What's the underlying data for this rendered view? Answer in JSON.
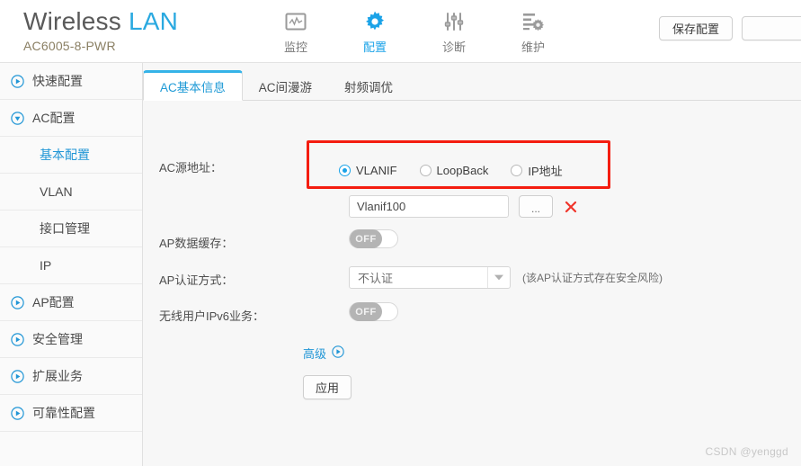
{
  "header": {
    "brand_primary": "Wireless",
    "brand_accent": "LAN",
    "model": "AC6005-8-PWR",
    "nav": [
      {
        "label": "监控",
        "icon": "monitor-chart-icon",
        "active": false
      },
      {
        "label": "配置",
        "icon": "gear-icon",
        "active": true
      },
      {
        "label": "诊断",
        "icon": "sliders-icon",
        "active": false
      },
      {
        "label": "维护",
        "icon": "maintenance-gear-list-icon",
        "active": false
      }
    ],
    "buttons": [
      {
        "label": "保存配置",
        "name": "save-config-button"
      },
      {
        "label": "",
        "name": "secondary-toolbar-button"
      }
    ]
  },
  "sidebar": {
    "items": [
      {
        "label": "快速配置",
        "icon": "circle-play-icon",
        "type": "group",
        "expanded": false,
        "active": false
      },
      {
        "label": "AC配置",
        "icon": "circle-chevron-down-icon",
        "type": "group",
        "expanded": true,
        "active": false
      },
      {
        "label": "基本配置",
        "type": "sub",
        "active": true
      },
      {
        "label": "VLAN",
        "type": "sub",
        "active": false
      },
      {
        "label": "接口管理",
        "type": "sub",
        "active": false
      },
      {
        "label": "IP",
        "type": "sub",
        "active": false
      },
      {
        "label": "AP配置",
        "icon": "circle-play-icon",
        "type": "group",
        "expanded": false,
        "active": false
      },
      {
        "label": "安全管理",
        "icon": "circle-play-icon",
        "type": "group",
        "expanded": false,
        "active": false
      },
      {
        "label": "扩展业务",
        "icon": "circle-play-icon",
        "type": "group",
        "expanded": false,
        "active": false
      },
      {
        "label": "可靠性配置",
        "icon": "circle-play-icon",
        "type": "group",
        "expanded": false,
        "active": false
      }
    ]
  },
  "main": {
    "tabs": [
      {
        "label": "AC基本信息",
        "active": true
      },
      {
        "label": "AC间漫游",
        "active": false
      },
      {
        "label": "射频调优",
        "active": false
      }
    ],
    "form": {
      "source_address": {
        "label": "AC源地址：",
        "options": [
          {
            "label": "VLANIF",
            "checked": true
          },
          {
            "label": "LoopBack",
            "checked": false
          },
          {
            "label": "IP地址",
            "checked": false
          }
        ],
        "value": "Vlanif100",
        "placeholder": "",
        "browse_label": "...",
        "clear_icon": "red-x-icon"
      },
      "ap_data_cache": {
        "label": "AP数据缓存：",
        "state": "OFF"
      },
      "ap_auth_mode": {
        "label": "AP认证方式：",
        "value": "不认证",
        "hint": "(该AP认证方式存在安全风险)"
      },
      "wireless_ipv6": {
        "label": "无线用户IPv6业务：",
        "state": "OFF"
      },
      "advanced_label": "高级",
      "apply_label": "应用"
    }
  },
  "annotation": {
    "highlight_color": "#f41d10"
  },
  "watermark": "CSDN @yenggd"
}
